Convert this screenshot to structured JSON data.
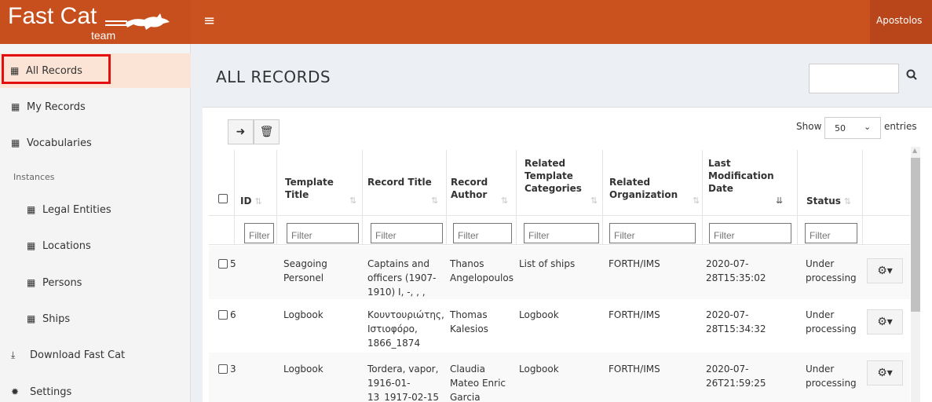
{
  "header": {
    "logo_text": "Fast Cat",
    "logo_sub": "team",
    "user": "Apostolos"
  },
  "sidebar": {
    "items": [
      {
        "label": "All Records"
      },
      {
        "label": "My Records"
      },
      {
        "label": "Vocabularies"
      },
      {
        "label": "Legal Entities"
      },
      {
        "label": "Locations"
      },
      {
        "label": "Persons"
      },
      {
        "label": "Ships"
      },
      {
        "label": "Download Fast Cat"
      },
      {
        "label": "Settings"
      }
    ],
    "section_header": "Instances"
  },
  "page": {
    "title": "ALL RECORDS"
  },
  "table_controls": {
    "show_label": "Show",
    "entries_value": "50",
    "entries_label": "entries"
  },
  "table": {
    "headers": {
      "id": "ID",
      "template_title": "Template Title",
      "record_title": "Record Title",
      "record_author": "Record Author",
      "related_template_categories": "Related Template Categories",
      "related_organization": "Related Organization",
      "last_modification_date": "Last Modification Date",
      "status": "Status"
    },
    "filter_placeholder": "Filter",
    "rows": [
      {
        "id": "5",
        "template": "Seagoing Personel",
        "title": "Captains and officers (1907-1910) I, -, , ,",
        "author": "Thanos Angelopoulos",
        "categories": "List of ships",
        "org": "FORTH/IMS",
        "date": "2020-07-28T15:35:02",
        "status": "Under processing"
      },
      {
        "id": "6",
        "template": "Logbook",
        "title": "Κουντουριώτης, Ιστιοφόρο, 1866_1874",
        "author": "Thomas Kalesios",
        "categories": "Logbook",
        "org": "FORTH/IMS",
        "date": "2020-07-28T15:34:32",
        "status": "Under processing"
      },
      {
        "id": "3",
        "template": "Logbook",
        "title": "Tordera, vapor, 1916-01-13_1917-02-15",
        "author": "Claudia Mateo Enric Garcia",
        "categories": "Logbook",
        "org": "FORTH/IMS",
        "date": "2020-07-26T21:59:25",
        "status": "Under processing"
      }
    ]
  },
  "colors": {
    "header": "#c9521f",
    "highlight_box": "#e30f0f",
    "active_item_bg": "#fbe3d6"
  },
  "icons": [
    "table-icon",
    "menu-icon",
    "search-icon",
    "export-icon",
    "trash-icon",
    "gear-icon",
    "download-icon",
    "cog-icon",
    "sort-icon",
    "cat-logo-icon"
  ]
}
